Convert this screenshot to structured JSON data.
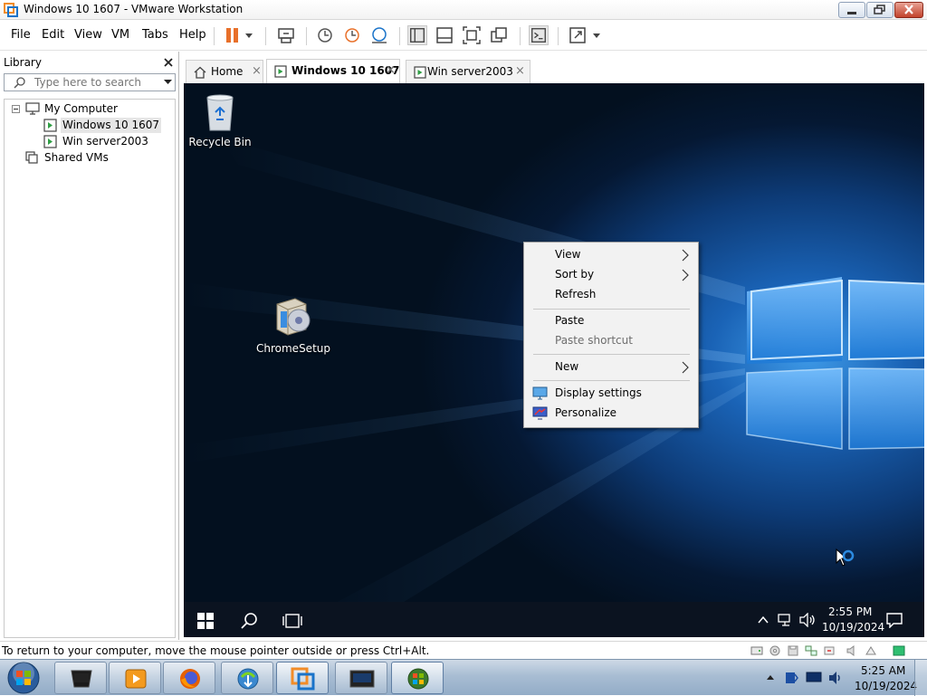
{
  "window": {
    "title": "Windows 10 1607 - VMware Workstation"
  },
  "menubar": {
    "items": [
      "File",
      "Edit",
      "View",
      "VM",
      "Tabs",
      "Help"
    ]
  },
  "library": {
    "title": "Library",
    "search_placeholder": "Type here to search",
    "tree": [
      {
        "label": "My Computer",
        "icon": "computer-icon",
        "expanded": true
      },
      {
        "label": "Windows 10 1607",
        "icon": "vm-icon",
        "selected": true
      },
      {
        "label": "Win server2003",
        "icon": "vm-icon"
      },
      {
        "label": "Shared VMs",
        "icon": "shared-vms-icon"
      }
    ]
  },
  "tabs": [
    {
      "label": "Home",
      "icon": "home-icon",
      "active": false
    },
    {
      "label": "Windows 10 1607",
      "icon": "vm-icon",
      "active": true
    },
    {
      "label": "Win server2003",
      "icon": "vm-icon",
      "active": false
    }
  ],
  "guest": {
    "desktop_icons": [
      {
        "label": "Recycle Bin",
        "icon": "recycle-bin-icon"
      },
      {
        "label": "ChromeSetup",
        "icon": "installer-icon"
      }
    ],
    "context_menu": {
      "items": [
        {
          "label": "View",
          "submenu": true
        },
        {
          "label": "Sort by",
          "submenu": true
        },
        {
          "label": "Refresh"
        },
        {
          "label": "Paste"
        },
        {
          "label": "Paste shortcut",
          "disabled": true
        },
        {
          "label": "New",
          "submenu": true
        },
        {
          "label": "Display settings",
          "icon": "display-settings-icon"
        },
        {
          "label": "Personalize",
          "icon": "personalize-icon"
        }
      ]
    },
    "taskbar": {
      "time": "2:55 PM",
      "date": "10/19/2024"
    }
  },
  "statusbar": {
    "text": "To return to your computer, move the mouse pointer outside or press Ctrl+Alt."
  },
  "host_taskbar": {
    "time": "5:25 AM",
    "date": "10/19/2024"
  },
  "colors": {
    "accent_orange": "#e8702a",
    "guest_taskbar": "#0b1320",
    "host_taskbar": "#a8bdd3"
  }
}
